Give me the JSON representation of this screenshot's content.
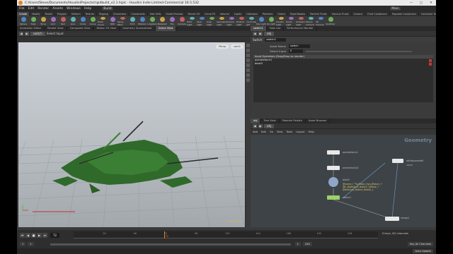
{
  "window": {
    "title": "C:/Users/Steve/Documents/HoudiniProjects/rigidbuild_v2.1.hiplc - Houdini Indie Limited-Commercial 16.5.532",
    "controls": [
      "—",
      "□",
      "✕"
    ]
  },
  "menu": {
    "items": [
      "File",
      "Edit",
      "Render",
      "Assets",
      "Windows",
      "Help"
    ],
    "build_label": "Build",
    "desktop_label": "Main"
  },
  "shelf_tabs": [
    "Create",
    "Modify",
    "Model",
    "Polygon",
    "Deform",
    "Texture",
    "Rigging",
    "Characters",
    "Constraints",
    "Hair Utils",
    "Guide Process",
    "Terrain FX",
    "Cloud FX",
    "Volume",
    "Lights",
    "Collisions",
    "Particles",
    "Grains",
    "Rigid Bodies",
    "Particle Fluids",
    "Viscous Fluids",
    "Oceans",
    "Fluid Containers",
    "Populate Containers",
    "Container Tools",
    "Pyro FX",
    "Sparse Pyro FX",
    "FEM",
    "Wires",
    "Crowds",
    "Drive Simulation"
  ],
  "shelf_tools": [
    "Sphere",
    "Tube",
    "Torus",
    "Grid",
    "Null",
    "Line",
    "Circle",
    "Curve",
    "Draw Curve",
    "Path",
    "Spray Paint",
    "Font",
    "Platonic",
    "L-System",
    "Metaball",
    "File",
    "Camera",
    "Point Light",
    "Spot Light",
    "Area Light",
    "Geometry Light",
    "Volume Light",
    "Distant Light",
    "Environment Light",
    "Sky Light",
    "GI Light",
    "Caustic Light",
    "Portal Light",
    "Ambient Light",
    "Stereo Camera",
    "VR Camera",
    "Switcher"
  ],
  "left_tabs": [
    "Animation Editor",
    "Render View",
    "Composite View",
    "Motion FX View",
    "Geometry Spreadsheet",
    "Scene View"
  ],
  "right_tabs": [
    "switch1",
    "Take List",
    "Performance Monitor"
  ],
  "viewport": {
    "node_path": "switch",
    "select_mode": "Select Input",
    "camera_menu": "Persp",
    "view_menu": "cam1",
    "status": "Indie Edition"
  },
  "params": {
    "path": "obj",
    "node_type": "Switch",
    "node_name": "switch1",
    "name_label": "Asset Name",
    "name_value": "switch",
    "select_input_label": "Select Input",
    "select_input_value": "0",
    "list_header": "Input Operators (Drag/Drop to reorder)",
    "inputs": [
      "pointdeform1",
      "blast3"
    ]
  },
  "network": {
    "tabs": [
      "obj",
      "Tree View",
      "Material Palette",
      "Asset Browser"
    ],
    "path": "obj",
    "menu": [
      "Add",
      "Edit",
      "Go",
      "View",
      "Tools",
      "Layout",
      "Help"
    ],
    "context_label": "Geometry",
    "nodes": [
      {
        "name": "pointdeform1",
        "color": "#e8e8e8"
      },
      {
        "name": "pointvelocity2",
        "color": "#e8e8e8"
      },
      {
        "name": "blast3",
        "color": "#8fa6c9",
        "note": "@name=^Tip/Rotor_Sync/Rotor1_*\n@h_BigRotor4_Rotor4_1/Rotor_*\n@bdSmall_Rotor4_Dead4_1"
      },
      {
        "name": "switch1",
        "color": "#9bd06b"
      },
      {
        "name": "attribpromote6",
        "color": "#e8e8e8",
        "note": "name"
      },
      {
        "name": "merge1",
        "color": "#e8e8e8"
      }
    ]
  },
  "timeline": {
    "frame": "72",
    "start": "1",
    "end": "240",
    "range_start": "1",
    "range_end": "1",
    "tick_labels": [
      "24",
      "48",
      "72",
      "96",
      "120",
      "144",
      "168",
      "192",
      "216"
    ],
    "keys_label": "0 keys, 0/0 channels",
    "key_all_label": "Key All Channels",
    "render_label": "Auto Update",
    "current_frame_label": "72"
  },
  "colors": {
    "app_bg": "#3a3a3a",
    "viewport_bg": "#c6cbd0",
    "geometry_green": "#2f6a2a",
    "accent_orange": "#f0801e",
    "switch_node": "#9bd06b",
    "blast_node": "#8fa6c9"
  }
}
